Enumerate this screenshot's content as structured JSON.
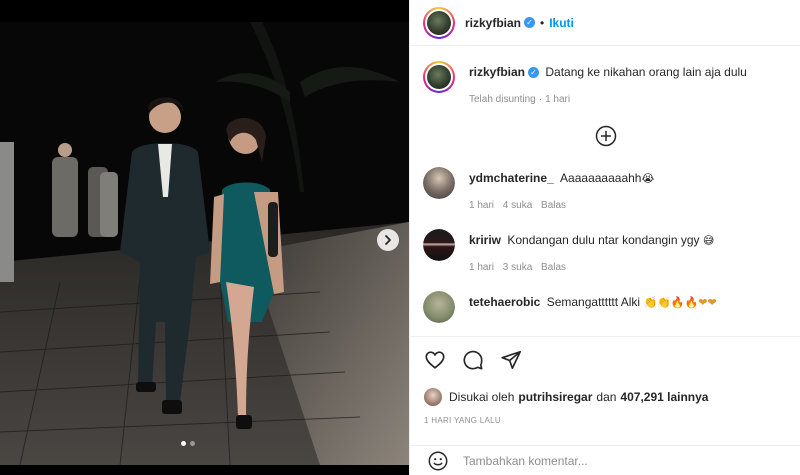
{
  "post": {
    "username": "rizkyfbian",
    "follow_label": "Ikuti",
    "separator": "•",
    "caption_text": "Datang ke nikahan orang lain aja dulu",
    "edited_label": "Telah disunting",
    "meta_sep": "·",
    "caption_time": "1 hari"
  },
  "comments": [
    {
      "username": "ydmchaterine_",
      "text": "Aaaaaaaaaahh",
      "emoji": "😭",
      "time": "1 hari",
      "likes": "4 suka",
      "reply": "Balas"
    },
    {
      "username": "kririw",
      "text": "Kondangan dulu ntar kondangin ygy",
      "emoji": "😅",
      "time": "1 hari",
      "likes": "3 suka",
      "reply": "Balas"
    },
    {
      "username": "tetehaerobic",
      "text": "Semangatttttt Alki",
      "emoji": "👏👏🔥🔥❤❤"
    }
  ],
  "likes": {
    "prefix": "Disukai oleh",
    "user": "putrihsiregar",
    "connector": "dan",
    "count": "407,291 lainnya"
  },
  "timestamp": "1 HARI YANG LALU",
  "add_comment": {
    "placeholder": "Tambahkan komentar..."
  },
  "carousel": {
    "current_index": 1,
    "total": 2
  },
  "icons": {
    "verified": "verified-badge-icon",
    "more": "add-circle-icon",
    "like": "heart-icon",
    "comment": "comment-bubble-icon",
    "share": "paper-plane-icon",
    "emoji": "smiley-icon",
    "next": "chevron-right-icon"
  },
  "colors": {
    "accent": "#0095f6",
    "verified": "#3897f0",
    "muted": "#8e8e8e"
  }
}
